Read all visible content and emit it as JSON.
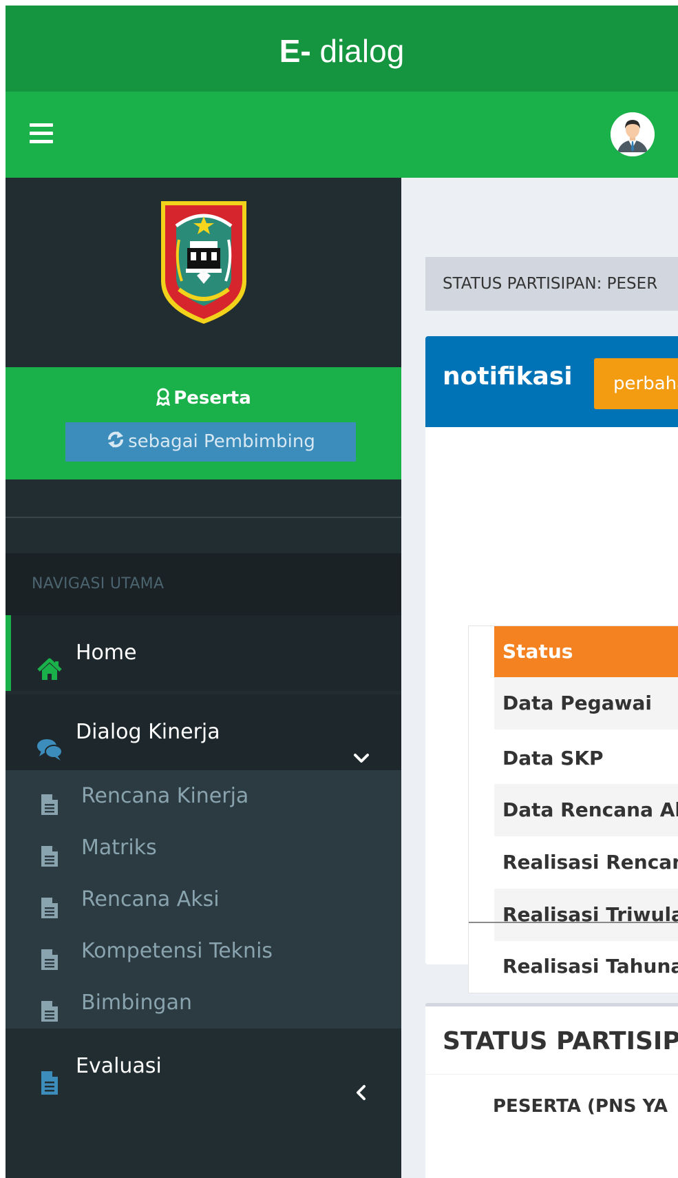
{
  "app": {
    "brand_bold": "E-",
    "brand_light": " dialog"
  },
  "colors": {
    "brand_bar": "#15953f",
    "nav_bar": "#1ab04a",
    "sidebar": "#222d32",
    "submenu": "#2c3b41",
    "primary": "#0073b7",
    "warning": "#f39c12",
    "table_header": "#f58220"
  },
  "navbar": {
    "menu_icon": "hamburger-icon",
    "avatar_icon": "user-avatar-icon"
  },
  "sidebar": {
    "role": "Peserta",
    "switch_button": "sebagai Pembimbing",
    "nav_header": "NAVIGASI UTAMA",
    "menu": [
      {
        "label": "Home",
        "icon": "home-icon"
      },
      {
        "label": "Dialog Kinerja",
        "icon": "comments-icon",
        "caret": "chevron-down-icon"
      },
      {
        "label": "Evaluasi",
        "icon": "file-icon",
        "caret": "chevron-left-icon"
      }
    ],
    "submenu": [
      {
        "label": "Rencana Kinerja",
        "icon": "file-text-icon"
      },
      {
        "label": "Matriks",
        "icon": "file-text-icon"
      },
      {
        "label": "Rencana Aksi",
        "icon": "file-text-icon"
      },
      {
        "label": "Kompetensi Teknis",
        "icon": "file-text-icon"
      },
      {
        "label": "Bimbingan",
        "icon": "file-text-icon"
      }
    ]
  },
  "content": {
    "status_strip": "STATUS PARTISIPAN: PESER",
    "notif_box": {
      "title": "notifikasi",
      "button": "perbaha",
      "table_header": "Status",
      "rows": [
        "Data Pegawai",
        "Data SKP",
        "Data Rencana Ak",
        "Realisasi Rencan",
        "Realisasi Triwula",
        "Realisasi Tahuna"
      ]
    },
    "status_box": {
      "title": "STATUS PARTISIPA",
      "subtitle": "PESERTA (PNS YA"
    }
  }
}
